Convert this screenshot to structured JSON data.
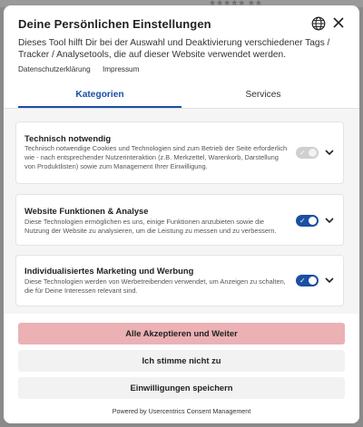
{
  "modal": {
    "title": "Deine Persönlichen Einstellungen",
    "description": "Dieses Tool hilft Dir bei der Auswahl und Deaktivierung verschiedener Tags / Tracker / Analysetools, die auf dieser Website verwendet werden.",
    "links": {
      "privacy": "Datenschutzerklärung",
      "imprint": "Impressum"
    },
    "icons": {
      "language": "globe-icon",
      "close": "close-icon"
    }
  },
  "tabs": [
    {
      "label": "Kategorien",
      "active": true
    },
    {
      "label": "Services",
      "active": false
    }
  ],
  "categories": [
    {
      "title": "Technisch notwendig",
      "description": "Technisch notwendige Cookies und Technologien sind zum Betrieb der Seite erforderlich wie  - nach entsprechender Nutzerinteraktion (z.B. Merkzettel, Warenkorb, Darstellung von Produktlisten) sowie zum Management Ihrer Einwilligung.",
      "enabled": true,
      "locked": true
    },
    {
      "title": "Website Funktionen & Analyse",
      "description": "Diese Technologien ermöglichen es uns, einige Funktionen anzubieten sowie die Nutzung der Website zu analysieren, um die Leistung zu messen und zu verbessern.",
      "enabled": true,
      "locked": false
    },
    {
      "title": "Individualisiertes Marketing und Werbung",
      "description": "Diese Technologien werden von Werbetreibenden verwendet, um Anzeigen zu schalten, die für Deine Interessen relevant sind.",
      "enabled": true,
      "locked": false
    }
  ],
  "buttons": {
    "accept_all": "Alle Akzeptieren und Weiter",
    "deny": "Ich stimme nicht zu",
    "save": "Einwilligungen speichern"
  },
  "footer": {
    "powered_by": "Powered by Usercentrics Consent Management"
  },
  "colors": {
    "accent": "#1a4fa3",
    "accept_button": "#ecb1b5",
    "secondary_button": "#f2f2f2",
    "content_background": "#f5f5f5"
  }
}
